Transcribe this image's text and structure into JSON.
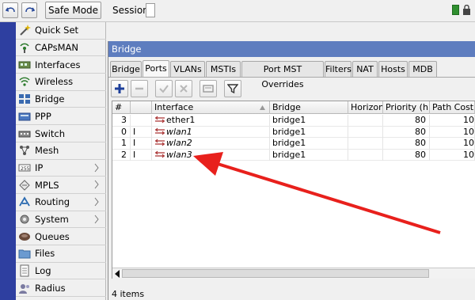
{
  "toolbar": {
    "undo_icon": "undo-icon",
    "redo_icon": "redo-icon",
    "safe_mode_label": "Safe Mode",
    "session_label": "Session:"
  },
  "sidebar": {
    "items": [
      {
        "label": "Quick Set",
        "icon": "wand-icon",
        "submenu": false
      },
      {
        "label": "CAPsMAN",
        "icon": "capsman-icon",
        "submenu": false
      },
      {
        "label": "Interfaces",
        "icon": "interfaces-icon",
        "submenu": false
      },
      {
        "label": "Wireless",
        "icon": "wireless-icon",
        "submenu": false
      },
      {
        "label": "Bridge",
        "icon": "bridge-icon",
        "submenu": false
      },
      {
        "label": "PPP",
        "icon": "ppp-icon",
        "submenu": false
      },
      {
        "label": "Switch",
        "icon": "switch-icon",
        "submenu": false
      },
      {
        "label": "Mesh",
        "icon": "mesh-icon",
        "submenu": false
      },
      {
        "label": "IP",
        "icon": "ip-icon",
        "submenu": true
      },
      {
        "label": "MPLS",
        "icon": "mpls-icon",
        "submenu": true
      },
      {
        "label": "Routing",
        "icon": "routing-icon",
        "submenu": true
      },
      {
        "label": "System",
        "icon": "system-icon",
        "submenu": true
      },
      {
        "label": "Queues",
        "icon": "queues-icon",
        "submenu": false
      },
      {
        "label": "Files",
        "icon": "files-icon",
        "submenu": false
      },
      {
        "label": "Log",
        "icon": "log-icon",
        "submenu": false
      },
      {
        "label": "Radius",
        "icon": "radius-icon",
        "submenu": false
      }
    ]
  },
  "window": {
    "title": "Bridge",
    "tabs": [
      "Bridge",
      "Ports",
      "VLANs",
      "MSTIs",
      "Port MST Overrides",
      "Filters",
      "NAT",
      "Hosts",
      "MDB"
    ],
    "active_tab": "Ports"
  },
  "table": {
    "columns": [
      "#",
      "",
      "Interface",
      "Bridge",
      "Horizon",
      "Priority (h...",
      "Path Cost"
    ],
    "rows": [
      {
        "num": "3",
        "flag": "",
        "interface": "ether1",
        "italic": false,
        "bridge": "bridge1",
        "horizon": "",
        "priority": "80",
        "path_cost": "10"
      },
      {
        "num": "0",
        "flag": "I",
        "interface": "wlan1",
        "italic": true,
        "bridge": "bridge1",
        "horizon": "",
        "priority": "80",
        "path_cost": "10"
      },
      {
        "num": "1",
        "flag": "I",
        "interface": "wlan2",
        "italic": true,
        "bridge": "bridge1",
        "horizon": "",
        "priority": "80",
        "path_cost": "10"
      },
      {
        "num": "2",
        "flag": "I",
        "interface": "wlan3",
        "italic": true,
        "bridge": "bridge1",
        "horizon": "",
        "priority": "80",
        "path_cost": "10"
      }
    ]
  },
  "status": {
    "items_count": "4 items"
  },
  "colors": {
    "title_bar": "#5e7dbf",
    "left_rail": "#2e3fa0",
    "annotation_arrow": "#e8201c"
  }
}
